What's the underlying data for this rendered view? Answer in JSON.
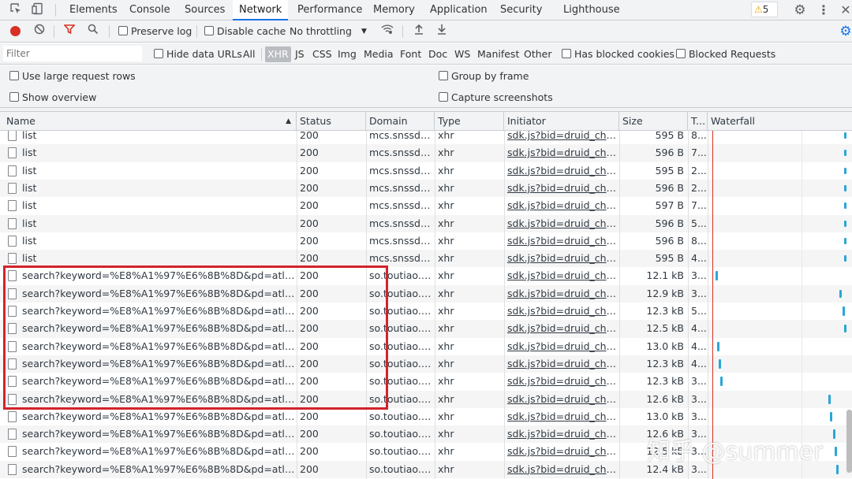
{
  "tabs": [
    "Elements",
    "Console",
    "Sources",
    "Network",
    "Performance",
    "Memory",
    "Application",
    "Security",
    "Lighthouse"
  ],
  "active_tab": "Network",
  "warning_count": "5",
  "toolbar": {
    "preserve_log": "Preserve log",
    "disable_cache": "Disable cache",
    "throttling": "No throttling"
  },
  "filter": {
    "placeholder": "Filter",
    "hide_data_urls": "Hide data URLs",
    "types": [
      "All",
      "XHR",
      "JS",
      "CSS",
      "Img",
      "Media",
      "Font",
      "Doc",
      "WS",
      "Manifest",
      "Other"
    ],
    "active_type": "XHR",
    "has_blocked_cookies": "Has blocked cookies",
    "blocked_requests": "Blocked Requests"
  },
  "options": {
    "large_rows": "Use large request rows",
    "group_by_frame": "Group by frame",
    "show_overview": "Show overview",
    "capture_screenshots": "Capture screenshots"
  },
  "columns": {
    "name": "Name",
    "status": "Status",
    "domain": "Domain",
    "type": "Type",
    "initiator": "Initiator",
    "size": "Size",
    "time": "T...",
    "waterfall": "Waterfall"
  },
  "rows": [
    {
      "name": "list",
      "status": "200",
      "domain": "mcs.snssdk...",
      "type": "xhr",
      "initiator": "sdk.js?bid=druid_chan...",
      "size": "595 B",
      "time": "8..."
    },
    {
      "name": "list",
      "status": "200",
      "domain": "mcs.snssdk...",
      "type": "xhr",
      "initiator": "sdk.js?bid=druid_chan...",
      "size": "596 B",
      "time": "7..."
    },
    {
      "name": "list",
      "status": "200",
      "domain": "mcs.snssdk...",
      "type": "xhr",
      "initiator": "sdk.js?bid=druid_chan...",
      "size": "595 B",
      "time": "2..."
    },
    {
      "name": "list",
      "status": "200",
      "domain": "mcs.snssdk...",
      "type": "xhr",
      "initiator": "sdk.js?bid=druid_chan...",
      "size": "596 B",
      "time": "2..."
    },
    {
      "name": "list",
      "status": "200",
      "domain": "mcs.snssdk...",
      "type": "xhr",
      "initiator": "sdk.js?bid=druid_chan...",
      "size": "597 B",
      "time": "7..."
    },
    {
      "name": "list",
      "status": "200",
      "domain": "mcs.snssdk...",
      "type": "xhr",
      "initiator": "sdk.js?bid=druid_chan...",
      "size": "596 B",
      "time": "5..."
    },
    {
      "name": "list",
      "status": "200",
      "domain": "mcs.snssdk...",
      "type": "xhr",
      "initiator": "sdk.js?bid=druid_chan...",
      "size": "596 B",
      "time": "8..."
    },
    {
      "name": "list",
      "status": "200",
      "domain": "mcs.snssdk...",
      "type": "xhr",
      "initiator": "sdk.js?bid=druid_chan...",
      "size": "595 B",
      "time": "4..."
    },
    {
      "name": "search?keyword=%E8%A1%97%E6%8B%8D&pd=atlas&dv...",
      "status": "200",
      "domain": "so.toutiao.c...",
      "type": "xhr",
      "initiator": "sdk.js?bid=druid_chan...",
      "size": "12.1 kB",
      "time": "3..."
    },
    {
      "name": "search?keyword=%E8%A1%97%E6%8B%8D&pd=atlas&dv...",
      "status": "200",
      "domain": "so.toutiao.c...",
      "type": "xhr",
      "initiator": "sdk.js?bid=druid_chan...",
      "size": "12.9 kB",
      "time": "3..."
    },
    {
      "name": "search?keyword=%E8%A1%97%E6%8B%8D&pd=atlas&dv...",
      "status": "200",
      "domain": "so.toutiao.c...",
      "type": "xhr",
      "initiator": "sdk.js?bid=druid_chan...",
      "size": "12.3 kB",
      "time": "5..."
    },
    {
      "name": "search?keyword=%E8%A1%97%E6%8B%8D&pd=atlas&dv...",
      "status": "200",
      "domain": "so.toutiao.c...",
      "type": "xhr",
      "initiator": "sdk.js?bid=druid_chan...",
      "size": "12.5 kB",
      "time": "4..."
    },
    {
      "name": "search?keyword=%E8%A1%97%E6%8B%8D&pd=atlas&dv...",
      "status": "200",
      "domain": "so.toutiao.c...",
      "type": "xhr",
      "initiator": "sdk.js?bid=druid_chan...",
      "size": "13.0 kB",
      "time": "4..."
    },
    {
      "name": "search?keyword=%E8%A1%97%E6%8B%8D&pd=atlas&dv...",
      "status": "200",
      "domain": "so.toutiao.c...",
      "type": "xhr",
      "initiator": "sdk.js?bid=druid_chan...",
      "size": "12.3 kB",
      "time": "4..."
    },
    {
      "name": "search?keyword=%E8%A1%97%E6%8B%8D&pd=atlas&dv...",
      "status": "200",
      "domain": "so.toutiao.c...",
      "type": "xhr",
      "initiator": "sdk.js?bid=druid_chan...",
      "size": "12.3 kB",
      "time": "3..."
    },
    {
      "name": "search?keyword=%E8%A1%97%E6%8B%8D&pd=atlas&dv...",
      "status": "200",
      "domain": "so.toutiao.c...",
      "type": "xhr",
      "initiator": "sdk.js?bid=druid_chan...",
      "size": "12.6 kB",
      "time": "3..."
    },
    {
      "name": "search?keyword=%E8%A1%97%E6%8B%8D&pd=atlas&dv...",
      "status": "200",
      "domain": "so.toutiao.c...",
      "type": "xhr",
      "initiator": "sdk.js?bid=druid_chan...",
      "size": "13.0 kB",
      "time": "3..."
    },
    {
      "name": "search?keyword=%E8%A1%97%E6%8B%8D&pd=atlas&dv...",
      "status": "200",
      "domain": "so.toutiao.c...",
      "type": "xhr",
      "initiator": "sdk.js?bid=druid_chan...",
      "size": "12.6 kB",
      "time": "3..."
    },
    {
      "name": "search?keyword=%E8%A1%97%E6%8B%8D&pd=atlas&dv...",
      "status": "200",
      "domain": "so.toutiao.c...",
      "type": "xhr",
      "initiator": "sdk.js?bid=druid_chan...",
      "size": "12.5 kB",
      "time": "3..."
    },
    {
      "name": "search?keyword=%E8%A1%97%E6%8B%8D&pd=atlas&dv...",
      "status": "200",
      "domain": "so.toutiao.c...",
      "type": "xhr",
      "initiator": "sdk.js?bid=druid_chan...",
      "size": "12.4 kB",
      "time": "3..."
    }
  ],
  "watermark": "知乎 @summer",
  "colors": {
    "accent": "#1a73e8",
    "record": "#d93025",
    "highlight_box": "#d3232c",
    "waterfall_bar": "#2aa6d8"
  }
}
